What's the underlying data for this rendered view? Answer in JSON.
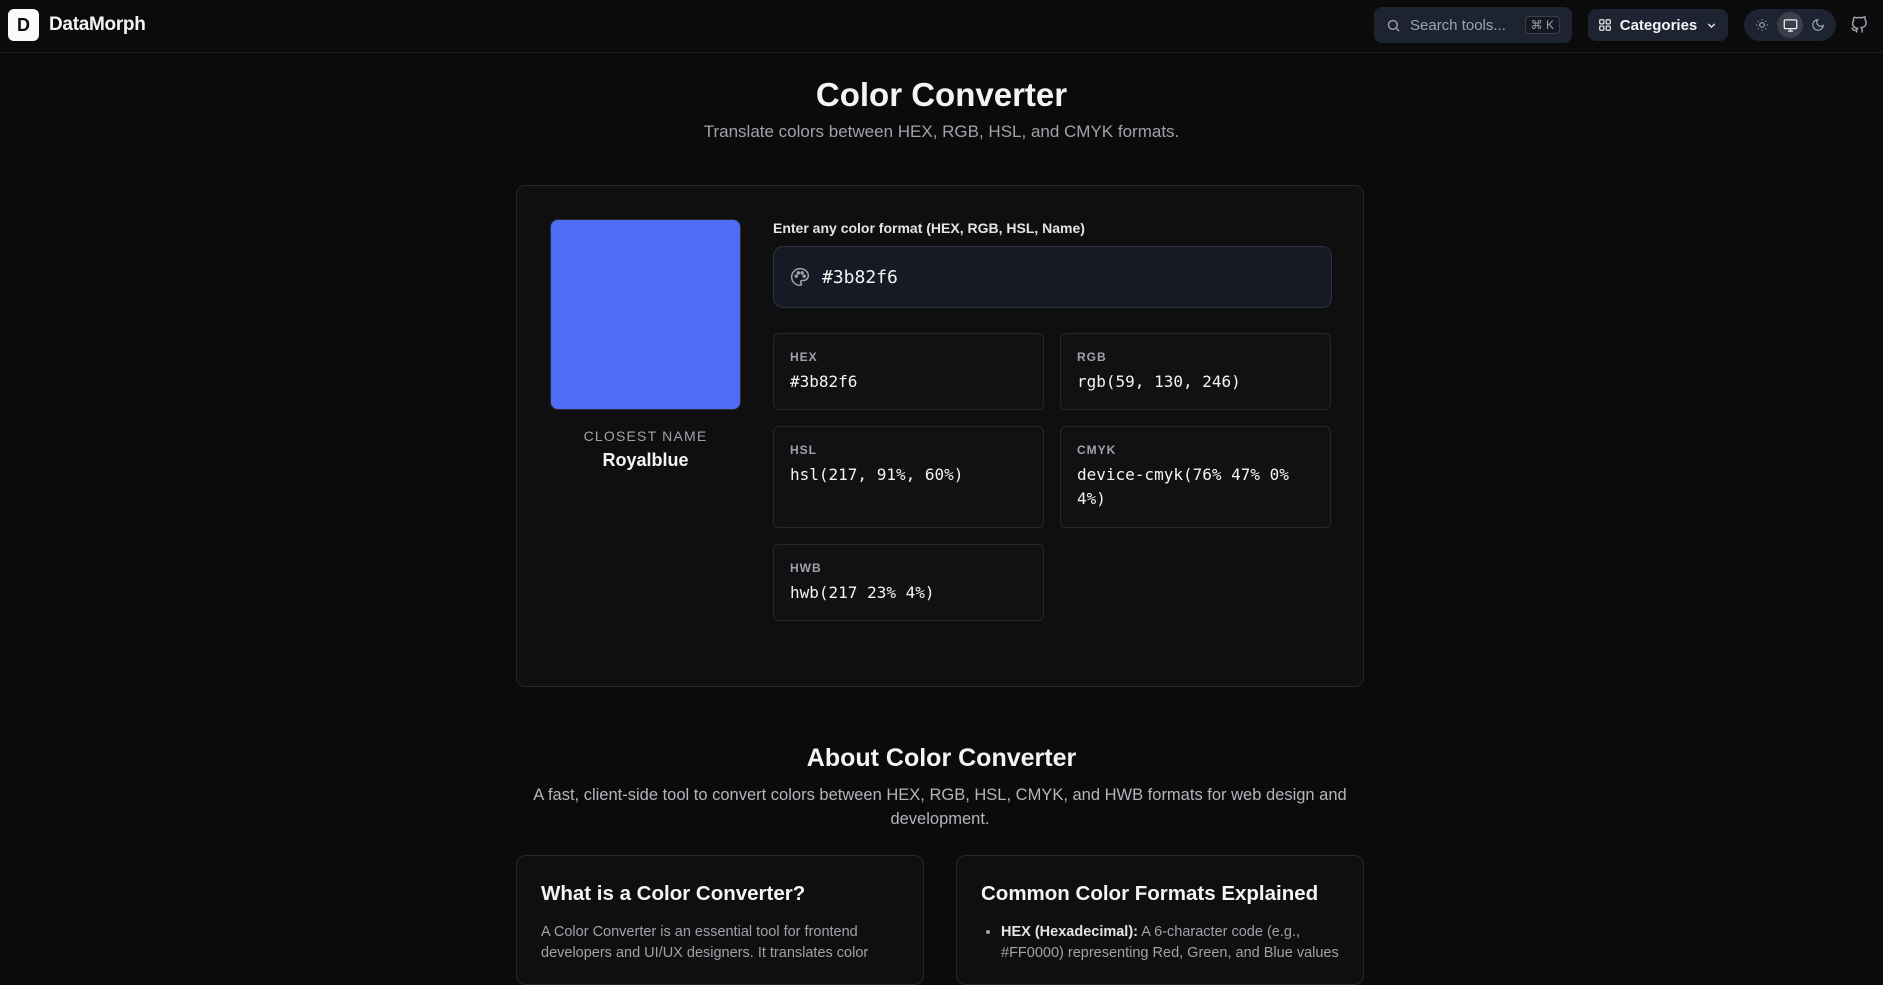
{
  "header": {
    "logo_letter": "D",
    "brand": "DataMorph",
    "search_placeholder": "Search tools...",
    "search_shortcut": "⌘ K",
    "categories_label": "Categories",
    "theme_modes": [
      "light-icon",
      "system-icon",
      "dark-icon"
    ],
    "active_theme": "system"
  },
  "page": {
    "title": "Color Converter",
    "subtitle": "Translate colors between HEX, RGB, HSL, and CMYK formats."
  },
  "converter": {
    "swatch_color": "#4f6cf7",
    "closest_label": "CLOSEST NAME",
    "closest_name": "Royalblue",
    "input_label": "Enter any color format (HEX, RGB, HSL, Name)",
    "input_value": "#3b82f6",
    "formats": {
      "hex": {
        "label": "HEX",
        "value": "#3b82f6"
      },
      "rgb": {
        "label": "RGB",
        "value": "rgb(59, 130, 246)"
      },
      "hsl": {
        "label": "HSL",
        "value": "hsl(217, 91%, 60%)"
      },
      "cmyk": {
        "label": "CMYK",
        "value": "device-cmyk(76% 47% 0% 4%)"
      },
      "hwb": {
        "label": "HWB",
        "value": "hwb(217 23% 4%)"
      }
    }
  },
  "about": {
    "title": "About Color Converter",
    "description": "A fast, client-side tool to convert colors between HEX, RGB, HSL, CMYK, and HWB formats for web design and development.",
    "what_title": "What is a Color Converter?",
    "what_text": "A Color Converter is an essential tool for frontend developers and UI/UX designers. It translates color",
    "formats_title": "Common Color Formats Explained",
    "formats_item_bold": "HEX (Hexadecimal):",
    "formats_item_text": " A 6-character code (e.g., #FF0000) representing Red, Green, and Blue values"
  }
}
